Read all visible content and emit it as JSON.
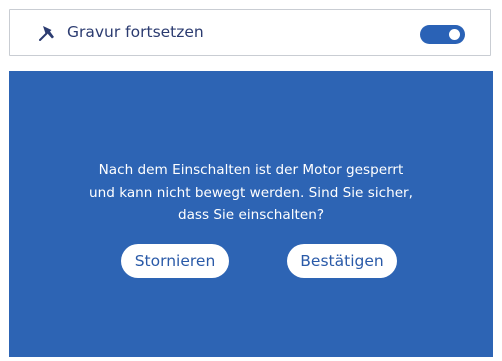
{
  "setting": {
    "icon": "pin-icon",
    "label": "Gravur fortsetzen",
    "toggle_on": true,
    "toggle_color": "#2a62b6"
  },
  "dialog": {
    "background": "#2d64b4",
    "message_lines": [
      "Nach dem Einschalten ist der Motor gesperrt",
      "und kann nicht bewegt werden. Sind Sie sicher,",
      "dass Sie einschalten?"
    ],
    "cancel_label": "Stornieren",
    "confirm_label": "Bestätigen"
  }
}
